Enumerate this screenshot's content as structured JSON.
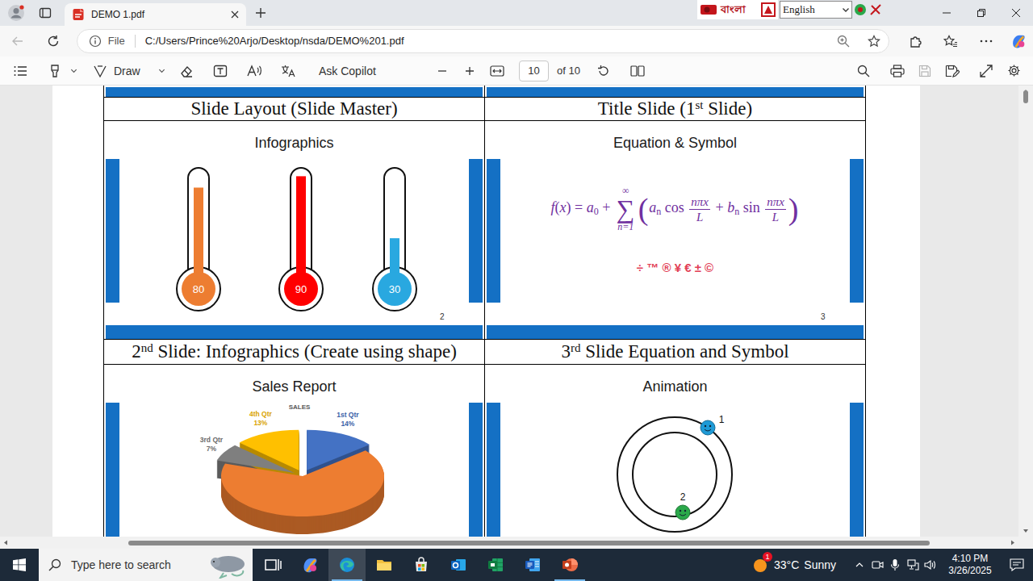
{
  "window": {
    "tabs": [
      {
        "label": "DEMO 1.pdf",
        "selected": true
      }
    ],
    "keyboard": {
      "language": "বাংলা",
      "layout": "English"
    }
  },
  "address_bar": {
    "back_disabled": true,
    "scheme": "File",
    "url": "C:/Users/Prince%20Arjo/Desktop/nsda/DEMO%201.pdf"
  },
  "pdf_toolbar": {
    "draw": "Draw",
    "ask": "Ask Copilot",
    "page": "10",
    "page_count": "of 10",
    "save_disabled": true
  },
  "document": {
    "captions": [
      [
        {
          "kind": "text",
          "text": "Slide Layout (Slide Master)"
        }
      ],
      [
        {
          "kind": "text",
          "text": "Title Slide (1"
        },
        {
          "kind": "sup",
          "text": "st"
        },
        {
          "kind": "text",
          "text": " Slide)"
        }
      ],
      [
        {
          "kind": "text",
          "text": "2"
        },
        {
          "kind": "sup",
          "text": "nd"
        },
        {
          "kind": "text",
          "text": " Slide: Infographics (Create using shape)"
        }
      ],
      [
        {
          "kind": "text",
          "text": "3"
        },
        {
          "kind": "sup",
          "text": "rd"
        },
        {
          "kind": "text",
          "text": " Slide Equation and Symbol"
        }
      ]
    ],
    "slides": [
      {
        "kind": "thermometers",
        "title": "Infographics",
        "number": "2",
        "thermometers": [
          {
            "value": "80",
            "level": 0.84,
            "color": "#ed7d31"
          },
          {
            "value": "90",
            "level": 0.95,
            "color": "#ff0000"
          },
          {
            "value": "30",
            "level": 0.35,
            "color": "#29a8e0"
          }
        ]
      },
      {
        "kind": "equation",
        "title": "Equation & Symbol",
        "number": "3",
        "equation": [
          {
            "kind": "i",
            "text": "f"
          },
          {
            "kind": "r",
            "text": "("
          },
          {
            "kind": "i",
            "text": "x"
          },
          {
            "kind": "r",
            "text": ") = "
          },
          {
            "kind": "i",
            "text": "a"
          },
          {
            "kind": "sub",
            "text": "0"
          },
          {
            "kind": "r",
            "text": " + "
          },
          {
            "kind": "sum",
            "text": "∑",
            "upper": "∞",
            "lower": "n=1"
          },
          {
            "kind": "big",
            "text": "("
          },
          {
            "kind": "i",
            "text": "a"
          },
          {
            "kind": "sub",
            "text": "n"
          },
          {
            "kind": "r",
            "text": " cos "
          },
          {
            "kind": "frac",
            "num": "nπx",
            "den": "L"
          },
          {
            "kind": "r",
            "text": " + "
          },
          {
            "kind": "i",
            "text": "b"
          },
          {
            "kind": "sub",
            "text": "n"
          },
          {
            "kind": "r",
            "text": " sin "
          },
          {
            "kind": "frac",
            "num": "nπx",
            "den": "L"
          },
          {
            "kind": "big",
            "text": ")"
          }
        ],
        "symbols": "÷ ™ ® ¥ € ± ©"
      },
      {
        "kind": "pie",
        "title": "Sales Report",
        "chart": {
          "title": "SALES",
          "slices": [
            {
              "label": "1st Qtr",
              "percent": "14%",
              "value": 14,
              "color": "#4472c4"
            },
            {
              "value": 66,
              "color": "#ed7d31"
            },
            {
              "label": "3rd Qtr",
              "percent": "7%",
              "value": 7,
              "color": "#7f7f7f"
            },
            {
              "label": "4th Qtr",
              "percent": "13%",
              "value": 13,
              "color": "#ffc000"
            }
          ]
        }
      },
      {
        "kind": "orbit",
        "title": "Animation",
        "dots": [
          {
            "label": "1",
            "color": "#1e9ad6"
          },
          {
            "label": "2",
            "color": "#2aa84a"
          }
        ]
      }
    ]
  },
  "scrollbars": {
    "vertical": {
      "level": 0.94
    },
    "horizontal": {
      "offset": 0.117,
      "level": 0.806
    }
  },
  "taskbar": {
    "search": {
      "placeholder": "Type here to search"
    },
    "apps": [
      {
        "kind": "taskview",
        "open": false,
        "selected": false
      },
      {
        "kind": "copilot",
        "open": false,
        "selected": false
      },
      {
        "kind": "edge",
        "open": true,
        "selected": true
      },
      {
        "kind": "explorer",
        "open": false,
        "selected": false
      },
      {
        "kind": "store",
        "open": false,
        "selected": false
      },
      {
        "kind": "outlook",
        "open": false,
        "selected": false
      },
      {
        "kind": "excel",
        "open": false,
        "selected": false
      },
      {
        "kind": "word",
        "open": false,
        "selected": false
      },
      {
        "kind": "powerpoint",
        "open": true,
        "selected": false
      }
    ],
    "weather": {
      "badge": "1",
      "temperature": "33°C",
      "condition": "Sunny"
    },
    "clock": {
      "time": "4:10 PM",
      "date": "3/26/2025"
    }
  }
}
